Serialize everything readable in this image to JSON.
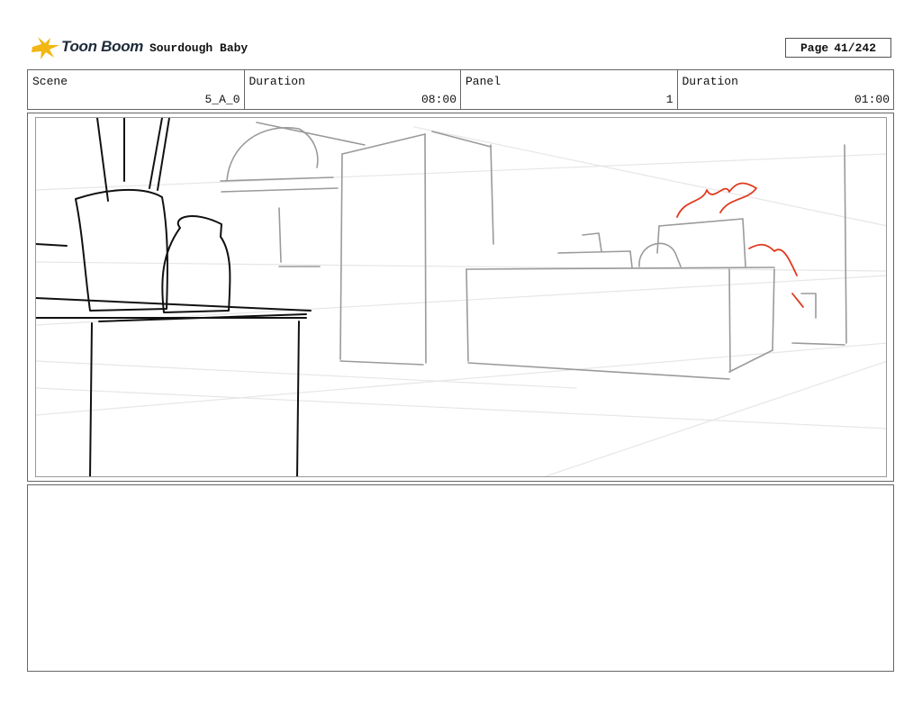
{
  "header": {
    "brand": "Toon Boom",
    "project_title": "Sourdough Baby",
    "page_label": "Page",
    "page_number": "41/242"
  },
  "info": {
    "scene_label": "Scene",
    "scene_value": "5_A_0",
    "duration_label": "Duration",
    "duration_value": "08:00",
    "panel_label": "Panel",
    "panel_value": "1",
    "panel_duration_label": "Duration",
    "panel_duration_value": "01:00"
  },
  "colors": {
    "brand_yellow": "#f2b713",
    "sketch_black": "#111111",
    "sketch_gray": "#9a9a9a",
    "sketch_red": "#e03a1e"
  }
}
